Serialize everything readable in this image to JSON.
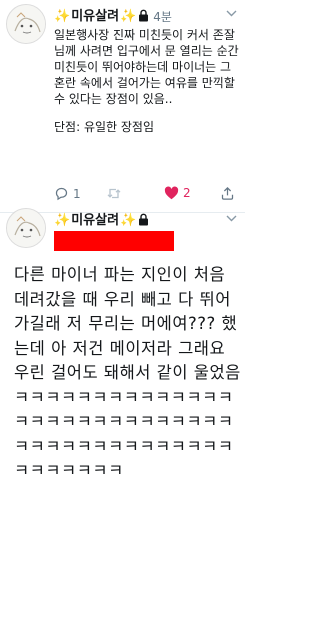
{
  "tweet1": {
    "display_name": "미유살려",
    "time": "4분",
    "text_main": "일본행사장 진짜 미친듯이 커서 존잘님께 사려면 입구에서 문 열리는 순간 미친듯이 뛰어야하는데 마이너는 그 혼란 속에서 걸어가는 여유를 만끽할 수 있다는 장점이 있음..",
    "text_footer": "단점: 유일한 장점임",
    "reply_count": "1",
    "like_count": "2"
  },
  "tweet2": {
    "display_name": "미유살려",
    "text": "다른 마이너 파는 지인이 처음 데려갔을 때 우리 빼고 다 뛰어가길래 저 무리는 머에여??? 했는데 아 저건 메이저라 그래요 우린 걸어도 돼해서 같이 울었음ㅋㅋㅋㅋㅋㅋㅋㅋㅋㅋㅋㅋㅋㅋㅋㅋㅋㅋㅋㅋㅋㅋㅋㅋㅋㅋㅋㅋㅋㅋㅋㅋㅋㅋㅋㅋㅋㅋㅋㅋㅋㅋㅋㅋㅋㅋㅋㅋㅋ"
  },
  "icons": {
    "sparkle": "✨",
    "lock": "lock-icon",
    "chevron": "chevron-down-icon",
    "reply": "reply-icon",
    "retweet": "retweet-icon",
    "like": "heart-icon",
    "share": "share-icon"
  },
  "colors": {
    "like_active": "#e0245e",
    "muted": "#657786",
    "redacted_bar": "#ff0000",
    "sparkle": "#f5b900"
  }
}
